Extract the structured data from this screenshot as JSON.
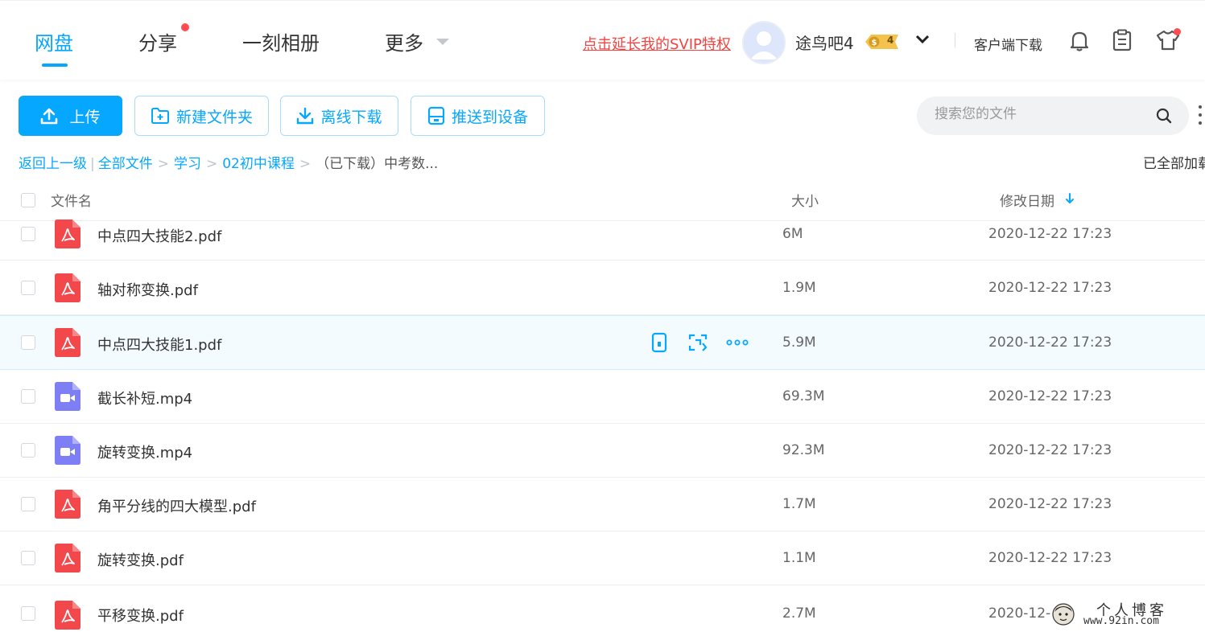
{
  "nav": {
    "tabs": [
      {
        "label": "网盘",
        "active": true
      },
      {
        "label": "分享",
        "has_dot": true
      },
      {
        "label": "一刻相册"
      },
      {
        "label": "更多"
      }
    ],
    "svip_link": "点击延长我的SVIP特权",
    "username": "途鸟吧4",
    "level_badge": "4",
    "client_download": "客户端下载"
  },
  "toolbar": {
    "upload": "上传",
    "new_folder": "新建文件夹",
    "offline_download": "离线下载",
    "push_to_device": "推送到设备",
    "search_placeholder": "搜索您的文件"
  },
  "breadcrumb": {
    "back": "返回上一级",
    "items": [
      "全部文件",
      "学习",
      "02初中课程"
    ],
    "current": "（已下载）中考数...",
    "status": "已全部加载"
  },
  "table": {
    "headers": {
      "name": "文件名",
      "size": "大小",
      "modified": "修改日期"
    },
    "sort": "修改日期 descending",
    "rows": [
      {
        "name": "中点四大技能2.pdf",
        "type": "pdf",
        "size": "6M",
        "date": "2020-12-22 17:23"
      },
      {
        "name": "轴对称变换.pdf",
        "type": "pdf",
        "size": "1.9M",
        "date": "2020-12-22 17:23"
      },
      {
        "name": "中点四大技能1.pdf",
        "type": "pdf",
        "size": "5.9M",
        "date": "2020-12-22 17:23",
        "hovered": true
      },
      {
        "name": "截长补短.mp4",
        "type": "video",
        "size": "69.3M",
        "date": "2020-12-22 17:23"
      },
      {
        "name": "旋转变换.mp4",
        "type": "video",
        "size": "92.3M",
        "date": "2020-12-22 17:23"
      },
      {
        "name": "角平分线的四大模型.pdf",
        "type": "pdf",
        "size": "1.7M",
        "date": "2020-12-22 17:23"
      },
      {
        "name": "旋转变换.pdf",
        "type": "pdf",
        "size": "1.1M",
        "date": "2020-12-22 17:23"
      },
      {
        "name": "平移变换.pdf",
        "type": "pdf",
        "size": "2.7M",
        "date": "2020-12-"
      }
    ]
  },
  "watermark": {
    "line1": "个人博客",
    "line2": "www.92in.com"
  },
  "colors": {
    "accent": "#06a7ff",
    "pdf": "#f2484b",
    "video": "#7f7ff5",
    "svip": "#f5433f"
  },
  "icons": {
    "pdf": "pdf-file-icon",
    "video": "video-file-icon",
    "bell": "bell-icon",
    "clipboard": "clipboard-icon",
    "tshirt": "tshirt-icon",
    "search": "search-icon"
  }
}
